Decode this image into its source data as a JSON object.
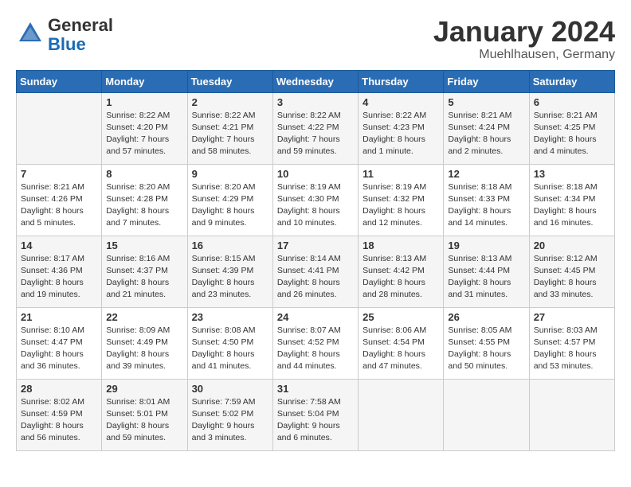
{
  "logo": {
    "general": "General",
    "blue": "Blue"
  },
  "header": {
    "month": "January 2024",
    "location": "Muehlhausen, Germany"
  },
  "weekdays": [
    "Sunday",
    "Monday",
    "Tuesday",
    "Wednesday",
    "Thursday",
    "Friday",
    "Saturday"
  ],
  "weeks": [
    [
      {
        "day": "",
        "info": ""
      },
      {
        "day": "1",
        "info": "Sunrise: 8:22 AM\nSunset: 4:20 PM\nDaylight: 7 hours\nand 57 minutes."
      },
      {
        "day": "2",
        "info": "Sunrise: 8:22 AM\nSunset: 4:21 PM\nDaylight: 7 hours\nand 58 minutes."
      },
      {
        "day": "3",
        "info": "Sunrise: 8:22 AM\nSunset: 4:22 PM\nDaylight: 7 hours\nand 59 minutes."
      },
      {
        "day": "4",
        "info": "Sunrise: 8:22 AM\nSunset: 4:23 PM\nDaylight: 8 hours\nand 1 minute."
      },
      {
        "day": "5",
        "info": "Sunrise: 8:21 AM\nSunset: 4:24 PM\nDaylight: 8 hours\nand 2 minutes."
      },
      {
        "day": "6",
        "info": "Sunrise: 8:21 AM\nSunset: 4:25 PM\nDaylight: 8 hours\nand 4 minutes."
      }
    ],
    [
      {
        "day": "7",
        "info": "Sunrise: 8:21 AM\nSunset: 4:26 PM\nDaylight: 8 hours\nand 5 minutes."
      },
      {
        "day": "8",
        "info": "Sunrise: 8:20 AM\nSunset: 4:28 PM\nDaylight: 8 hours\nand 7 minutes."
      },
      {
        "day": "9",
        "info": "Sunrise: 8:20 AM\nSunset: 4:29 PM\nDaylight: 8 hours\nand 9 minutes."
      },
      {
        "day": "10",
        "info": "Sunrise: 8:19 AM\nSunset: 4:30 PM\nDaylight: 8 hours\nand 10 minutes."
      },
      {
        "day": "11",
        "info": "Sunrise: 8:19 AM\nSunset: 4:32 PM\nDaylight: 8 hours\nand 12 minutes."
      },
      {
        "day": "12",
        "info": "Sunrise: 8:18 AM\nSunset: 4:33 PM\nDaylight: 8 hours\nand 14 minutes."
      },
      {
        "day": "13",
        "info": "Sunrise: 8:18 AM\nSunset: 4:34 PM\nDaylight: 8 hours\nand 16 minutes."
      }
    ],
    [
      {
        "day": "14",
        "info": "Sunrise: 8:17 AM\nSunset: 4:36 PM\nDaylight: 8 hours\nand 19 minutes."
      },
      {
        "day": "15",
        "info": "Sunrise: 8:16 AM\nSunset: 4:37 PM\nDaylight: 8 hours\nand 21 minutes."
      },
      {
        "day": "16",
        "info": "Sunrise: 8:15 AM\nSunset: 4:39 PM\nDaylight: 8 hours\nand 23 minutes."
      },
      {
        "day": "17",
        "info": "Sunrise: 8:14 AM\nSunset: 4:41 PM\nDaylight: 8 hours\nand 26 minutes."
      },
      {
        "day": "18",
        "info": "Sunrise: 8:13 AM\nSunset: 4:42 PM\nDaylight: 8 hours\nand 28 minutes."
      },
      {
        "day": "19",
        "info": "Sunrise: 8:13 AM\nSunset: 4:44 PM\nDaylight: 8 hours\nand 31 minutes."
      },
      {
        "day": "20",
        "info": "Sunrise: 8:12 AM\nSunset: 4:45 PM\nDaylight: 8 hours\nand 33 minutes."
      }
    ],
    [
      {
        "day": "21",
        "info": "Sunrise: 8:10 AM\nSunset: 4:47 PM\nDaylight: 8 hours\nand 36 minutes."
      },
      {
        "day": "22",
        "info": "Sunrise: 8:09 AM\nSunset: 4:49 PM\nDaylight: 8 hours\nand 39 minutes."
      },
      {
        "day": "23",
        "info": "Sunrise: 8:08 AM\nSunset: 4:50 PM\nDaylight: 8 hours\nand 41 minutes."
      },
      {
        "day": "24",
        "info": "Sunrise: 8:07 AM\nSunset: 4:52 PM\nDaylight: 8 hours\nand 44 minutes."
      },
      {
        "day": "25",
        "info": "Sunrise: 8:06 AM\nSunset: 4:54 PM\nDaylight: 8 hours\nand 47 minutes."
      },
      {
        "day": "26",
        "info": "Sunrise: 8:05 AM\nSunset: 4:55 PM\nDaylight: 8 hours\nand 50 minutes."
      },
      {
        "day": "27",
        "info": "Sunrise: 8:03 AM\nSunset: 4:57 PM\nDaylight: 8 hours\nand 53 minutes."
      }
    ],
    [
      {
        "day": "28",
        "info": "Sunrise: 8:02 AM\nSunset: 4:59 PM\nDaylight: 8 hours\nand 56 minutes."
      },
      {
        "day": "29",
        "info": "Sunrise: 8:01 AM\nSunset: 5:01 PM\nDaylight: 8 hours\nand 59 minutes."
      },
      {
        "day": "30",
        "info": "Sunrise: 7:59 AM\nSunset: 5:02 PM\nDaylight: 9 hours\nand 3 minutes."
      },
      {
        "day": "31",
        "info": "Sunrise: 7:58 AM\nSunset: 5:04 PM\nDaylight: 9 hours\nand 6 minutes."
      },
      {
        "day": "",
        "info": ""
      },
      {
        "day": "",
        "info": ""
      },
      {
        "day": "",
        "info": ""
      }
    ]
  ]
}
